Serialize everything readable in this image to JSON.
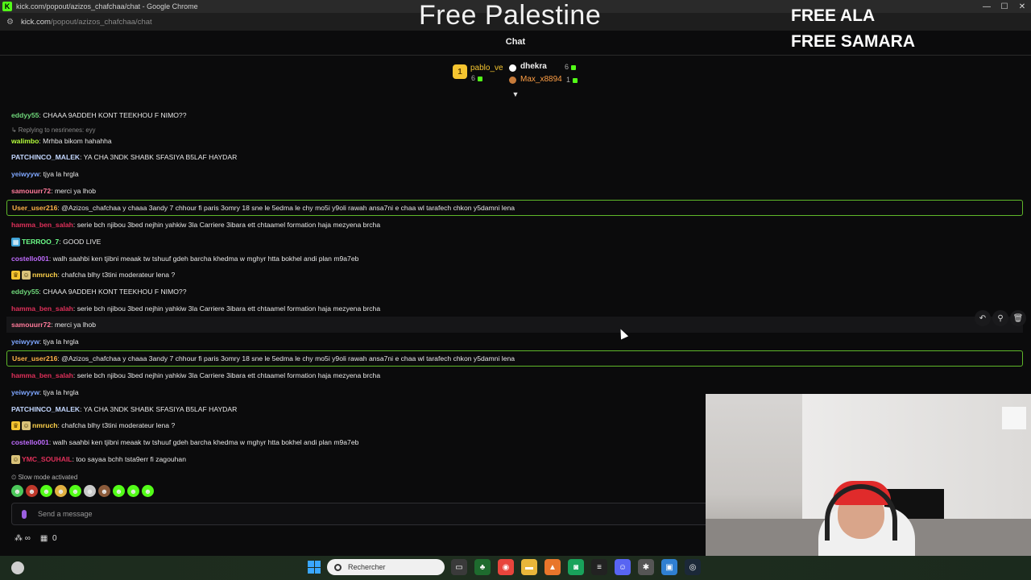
{
  "window": {
    "title": "kick.com/popout/azizos_chafchaa/chat - Google Chrome",
    "url_host": "kick.com",
    "url_path": "/popout/azizos_chafchaa/chat"
  },
  "overlay": {
    "headline": "Free Palestine",
    "right_line1": "FREE ALA",
    "right_line2": "FREE SAMARA"
  },
  "chat_header": {
    "title": "Chat"
  },
  "top_gifters": {
    "rank": "1",
    "first": {
      "name": "pablo_ve",
      "count": "6"
    },
    "second": {
      "name": "dhekra",
      "count": "6"
    },
    "third": {
      "name": "Max_x8894",
      "count": "1"
    }
  },
  "messages": [
    {
      "user": "eddyy55",
      "color": "#6fd77a",
      "text": "CHAAA 9ADDEH KONT TEEKHOU F NIMO??"
    },
    {
      "reply": "Replying to nesrinenes: eyy"
    },
    {
      "user": "walimbo",
      "color": "#b6ff3c",
      "text": "Mrhba bikom hahahha"
    },
    {
      "user": "PATCHINCO_MALEK",
      "color": "#c3d7ff",
      "text": "YA CHA 3NDK SHABK SFASIYA B5LAF HAYDAR"
    },
    {
      "user": "yeiwyyw",
      "color": "#7fa7ff",
      "text": "tjya la hrgla"
    },
    {
      "user": "samouurr72",
      "color": "#ff7a9a",
      "text": "merci ya lhob"
    },
    {
      "user": "User_user216",
      "color": "#ffb347",
      "text": "@Azizos_chafchaa y chaaa 3andy 7 chhour fi paris 3omry 18 sne le 5edma le chy mo5i y9oli rawah ansa7ni e chaa wl tarafech chkon y5damni lena"
    },
    {
      "user": "hamma_ben_salah",
      "color": "#e0305a",
      "text": "serie bch njibou 3bed nejhin yahkiw 3la Carriere 3ibara ett chtaamel formation haja mezyena brcha"
    },
    {
      "user": "TERROO_7",
      "color": "#6dff8a",
      "text": "GOOD LIVE"
    },
    {
      "user": "costello001",
      "color": "#c06cff",
      "text": "walh saahbi ken tjibni meaak tw tshuuf gdeh barcha khedma w mghyr htta bokhel andi plan m9a7eb"
    },
    {
      "user": "nmruch",
      "color": "#ffd24a",
      "text": "chafcha blhy t3tini moderateur lena ?"
    },
    {
      "user": "eddyy55",
      "color": "#6fd77a",
      "text": "CHAAA 9ADDEH KONT TEEKHOU F NIMO??"
    },
    {
      "user": "hamma_ben_salah",
      "color": "#e0305a",
      "text": "serie bch njibou 3bed nejhin yahkiw 3la Carriere 3ibara ett chtaamel formation haja mezyena brcha"
    },
    {
      "user": "samouurr72",
      "color": "#ff7a9a",
      "text": "merci ya lhob"
    },
    {
      "user": "yeiwyyw",
      "color": "#7fa7ff",
      "text": "tjya la hrgla"
    },
    {
      "user": "User_user216",
      "color": "#ffb347",
      "text": "@Azizos_chafchaa y chaaa 3andy 7 chhour fi paris 3omry 18 sne le 5edma le chy mo5i y9oli rawah ansa7ni e chaa wl tarafech chkon y5damni lena"
    },
    {
      "user": "hamma_ben_salah",
      "color": "#e0305a",
      "text": "serie bch njibou 3bed nejhin yahkiw 3la Carriere 3ibara ett chtaamel formation haja mezyena brcha"
    },
    {
      "user": "yeiwyyw",
      "color": "#7fa7ff",
      "text": "tjya la hrgla"
    },
    {
      "user": "PATCHINCO_MALEK",
      "color": "#c3d7ff",
      "text": "YA CHA 3NDK SHABK SFASIYA B5LAF HAYDAR"
    },
    {
      "user": "nmruch",
      "color": "#ffd24a",
      "text": "chafcha blhy t3tini moderateur lena ?"
    },
    {
      "user": "costello001",
      "color": "#c06cff",
      "text": "walh saahbi ken tjibni meaak tw tshuuf gdeh barcha khedma w mghyr htta bokhel andi plan m9a7eb"
    },
    {
      "user": "YMC_SOUHAIL",
      "color": "#e0305a",
      "text": "too sayaa bchh tsta9err fi zagouhan"
    }
  ],
  "slow_mode": "Slow mode activated",
  "input": {
    "placeholder": "Send a message"
  },
  "bottom": {
    "count": "0"
  },
  "taskbar": {
    "search_label": "Rechercher"
  }
}
